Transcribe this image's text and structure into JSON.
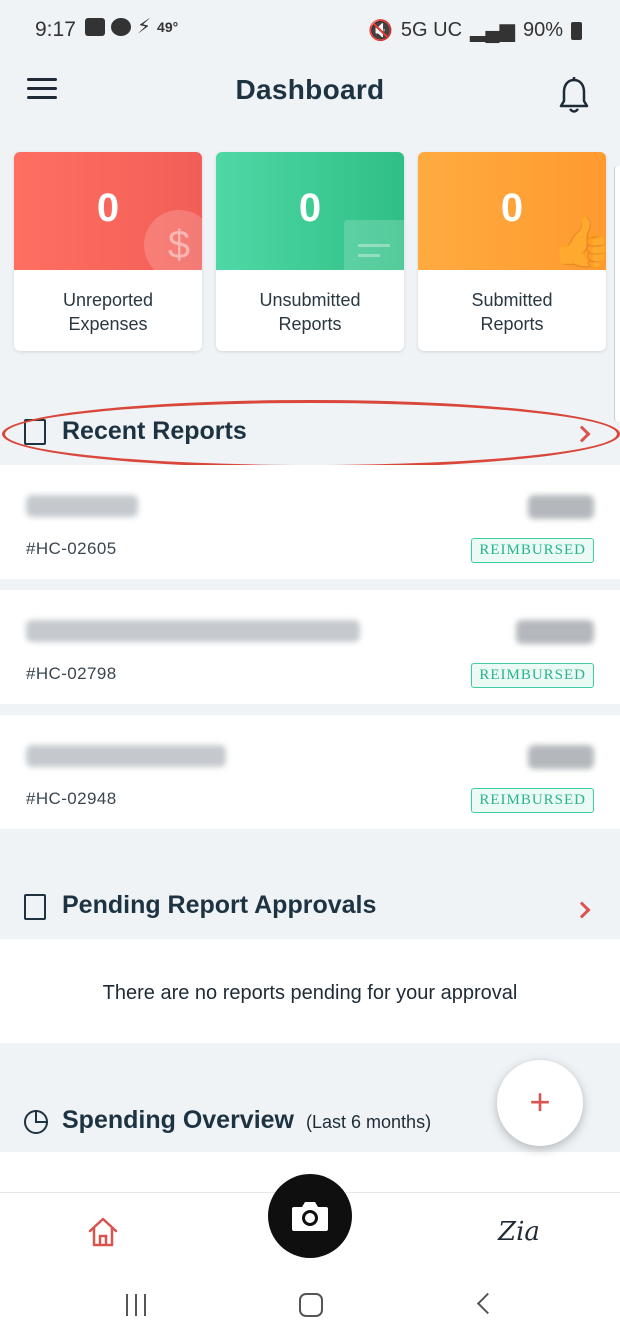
{
  "status_bar": {
    "time": "9:17",
    "temperature": "49°",
    "network": "5G UC",
    "battery": "90%"
  },
  "header": {
    "title": "Dashboard",
    "menu_icon": "hamburger-icon",
    "bell_icon": "bell-icon"
  },
  "cards": [
    {
      "count": "0",
      "label": "Unreported\nExpenses",
      "color": "#f8665b"
    },
    {
      "count": "0",
      "label": "Unsubmitted\nReports",
      "color": "#3ecc94"
    },
    {
      "count": "0",
      "label": "Submitted\nReports",
      "color": "#ffa53a"
    }
  ],
  "recent_reports": {
    "title": "Recent Reports",
    "items": [
      {
        "number": "#HC-02605",
        "status": "REIMBURSED"
      },
      {
        "number": "#HC-02798",
        "status": "REIMBURSED"
      },
      {
        "number": "#HC-02948",
        "status": "REIMBURSED"
      }
    ]
  },
  "pending_approvals": {
    "title": "Pending Report Approvals",
    "empty_message": "There are no reports pending for your approval"
  },
  "spending_overview": {
    "title": "Spending Overview",
    "subtitle": "(Last 6 months)"
  },
  "fab": {
    "label": "+"
  },
  "bottom_nav": {
    "home": "home-icon",
    "camera": "camera-icon",
    "zia": "Zia"
  },
  "colors": {
    "accent": "#d9534f",
    "badge_green": "#28b48c",
    "title_dark": "#1e3342"
  }
}
